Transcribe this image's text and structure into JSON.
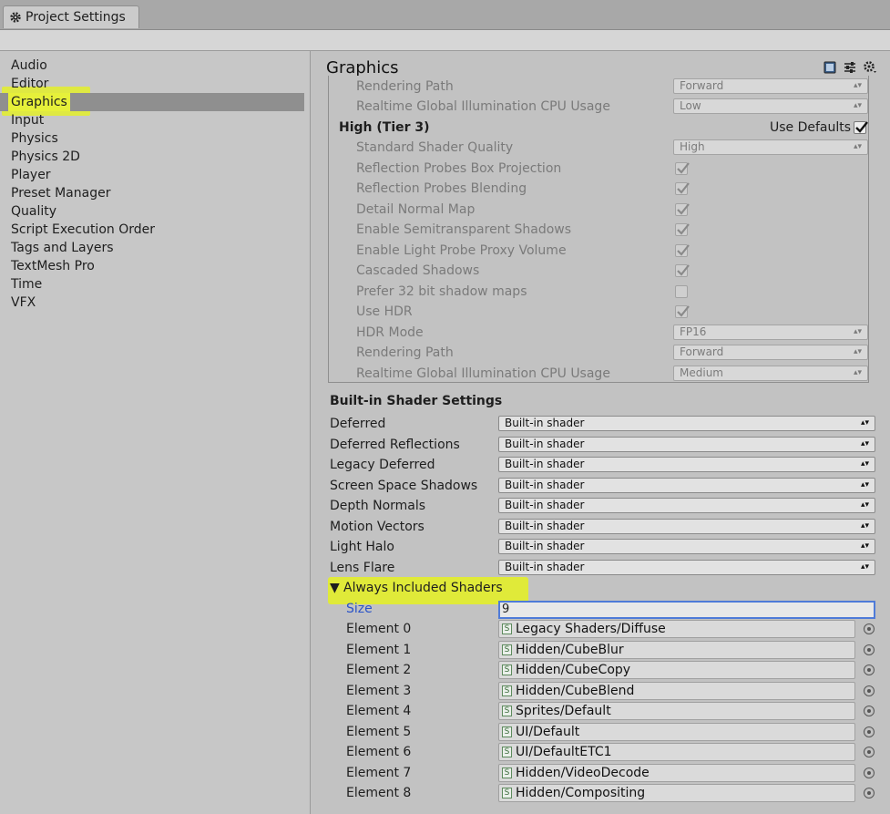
{
  "window": {
    "tab_title": "Project Settings"
  },
  "sidebar": {
    "items": [
      {
        "label": "Audio"
      },
      {
        "label": "Editor"
      },
      {
        "label": "Graphics"
      },
      {
        "label": "Input"
      },
      {
        "label": "Physics"
      },
      {
        "label": "Physics 2D"
      },
      {
        "label": "Player"
      },
      {
        "label": "Preset Manager"
      },
      {
        "label": "Quality"
      },
      {
        "label": "Script Execution Order"
      },
      {
        "label": "Tags and Layers"
      },
      {
        "label": "TextMesh Pro"
      },
      {
        "label": "Time"
      },
      {
        "label": "VFX"
      }
    ],
    "selected": "Graphics"
  },
  "main": {
    "title": "Graphics",
    "icons": [
      "book-icon",
      "sliders-icon",
      "gear-icon"
    ],
    "prev_tier": {
      "rendering_path_label": "Rendering Path",
      "rendering_path_value": "Forward",
      "gi_label": "Realtime Global Illumination CPU Usage",
      "gi_value": "Low"
    },
    "tier3": {
      "title": "High (Tier 3)",
      "use_defaults_label": "Use Defaults",
      "use_defaults_checked": true,
      "shader_quality_label": "Standard Shader Quality",
      "shader_quality_value": "High",
      "reflection_box_label": "Reflection Probes Box Projection",
      "reflection_blend_label": "Reflection Probes Blending",
      "detail_normal_label": "Detail Normal Map",
      "semitransparent_label": "Enable Semitransparent Shadows",
      "light_probe_label": "Enable Light Probe Proxy Volume",
      "cascaded_label": "Cascaded Shadows",
      "prefer32_label": "Prefer 32 bit shadow maps",
      "use_hdr_label": "Use HDR",
      "hdr_mode_label": "HDR Mode",
      "hdr_mode_value": "FP16",
      "rendering_path_label": "Rendering Path",
      "rendering_path_value": "Forward",
      "gi_label": "Realtime Global Illumination CPU Usage",
      "gi_value": "Medium"
    },
    "builtin": {
      "title": "Built-in Shader Settings",
      "rows": [
        {
          "label": "Deferred",
          "value": "Built-in shader"
        },
        {
          "label": "Deferred Reflections",
          "value": "Built-in shader"
        },
        {
          "label": "Legacy Deferred",
          "value": "Built-in shader"
        },
        {
          "label": "Screen Space Shadows",
          "value": "Built-in shader"
        },
        {
          "label": "Depth Normals",
          "value": "Built-in shader"
        },
        {
          "label": "Motion Vectors",
          "value": "Built-in shader"
        },
        {
          "label": "Light Halo",
          "value": "Built-in shader"
        },
        {
          "label": "Lens Flare",
          "value": "Built-in shader"
        }
      ]
    },
    "always": {
      "title": "Always Included Shaders",
      "size_label": "Size",
      "size_value": "9",
      "elements": [
        {
          "label": "Element 0",
          "value": "Legacy Shaders/Diffuse"
        },
        {
          "label": "Element 1",
          "value": "Hidden/CubeBlur"
        },
        {
          "label": "Element 2",
          "value": "Hidden/CubeCopy"
        },
        {
          "label": "Element 3",
          "value": "Hidden/CubeBlend"
        },
        {
          "label": "Element 4",
          "value": "Sprites/Default"
        },
        {
          "label": "Element 5",
          "value": "UI/Default"
        },
        {
          "label": "Element 6",
          "value": "UI/DefaultETC1"
        },
        {
          "label": "Element 7",
          "value": "Hidden/VideoDecode"
        },
        {
          "label": "Element 8",
          "value": "Hidden/Compositing"
        }
      ]
    }
  },
  "colors": {
    "highlight": "#e3ee2a",
    "selection": "#8f8f8f",
    "focus": "#4f7bd8"
  }
}
